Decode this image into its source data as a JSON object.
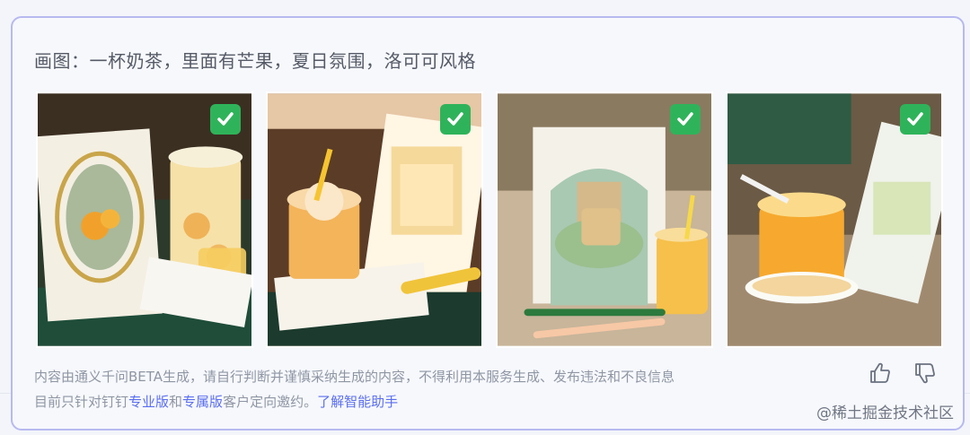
{
  "prompt_text": "画图：一杯奶茶，里面有芒果，夏日氛围，洛可可风格",
  "images": [
    {
      "selected": true,
      "icon": "check-icon"
    },
    {
      "selected": true,
      "icon": "check-icon"
    },
    {
      "selected": true,
      "icon": "check-icon"
    },
    {
      "selected": true,
      "icon": "check-icon"
    }
  ],
  "disclaimer": {
    "line1": "内容由通义千问BETA生成，请自行判断并谨慎采纳生成的内容，不得利用本服务生成、发布违法和不良信息",
    "line2_prefix": "目前只针对钉钉",
    "link_pro": "专业版",
    "and_text": "和",
    "link_exclusive": "专属版",
    "line2_suffix": "客户定向邀约。",
    "link_learn": "了解智能助手"
  },
  "feedback": {
    "like_icon": "thumbs-up-icon",
    "dislike_icon": "thumbs-down-icon"
  },
  "watermark": "@稀土掘金技术社区",
  "colors": {
    "accent": "#5b6ef0",
    "check": "#2fb35a",
    "border": "#b7b9f0"
  }
}
